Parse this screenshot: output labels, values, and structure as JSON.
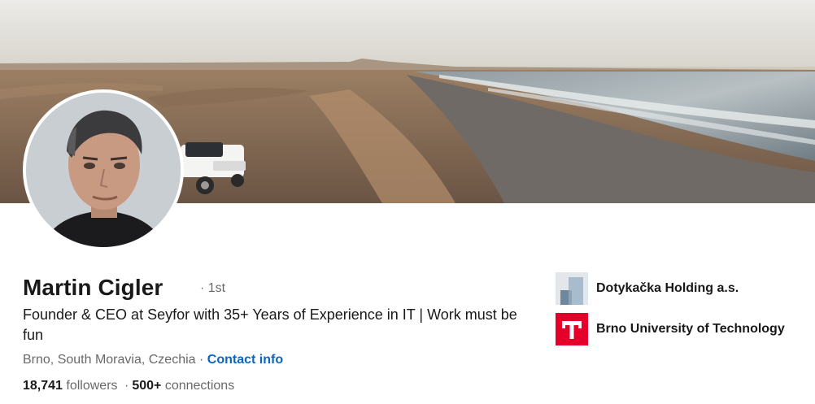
{
  "profile": {
    "name": "Martin Cigler",
    "degree": "· 1st",
    "headline": "Founder & CEO at Seyfor with 35+ Years of Experience in IT | Work must be fun",
    "location": "Brno, South Moravia, Czechia",
    "location_separator": " · ",
    "contact_info": "Contact info",
    "followers_count": "18,741",
    "followers_label": "followers",
    "stats_separator": "·",
    "connections_count": "500+",
    "connections_label": "connections"
  },
  "organizations": [
    {
      "name": "Dotykačka Holding a.s.",
      "logo_icon": "company-logo-icon"
    },
    {
      "name": "Brno University of Technology",
      "logo_icon": "university-logo-icon"
    }
  ],
  "colors": {
    "link_blue": "#0a66c2",
    "university_red": "#e4002b"
  }
}
